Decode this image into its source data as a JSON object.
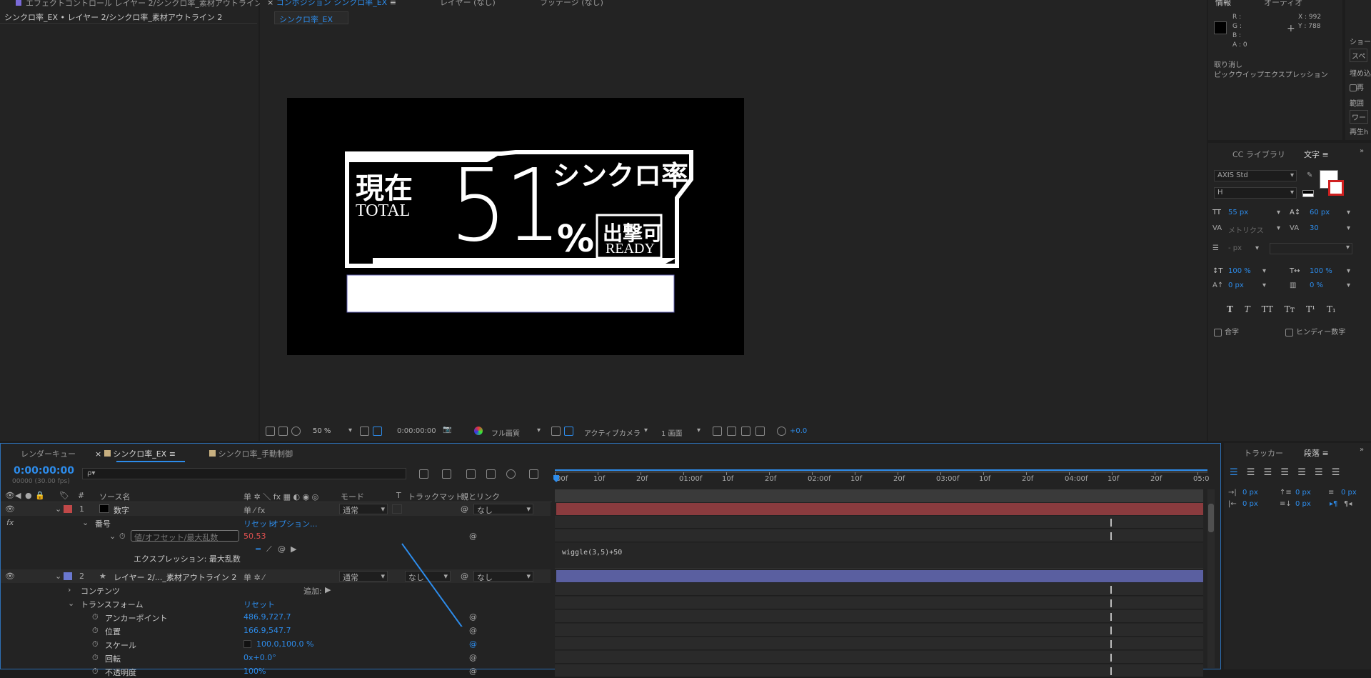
{
  "effects_panel": {
    "tab": "エフェクトコントロール レイヤー 2/シンクロ率_素材アウトライン 2",
    "breadcrumb": "シンクロ率_EX • レイヤー 2/シンクロ率_素材アウトライン 2"
  },
  "comp_panel": {
    "tab": "コンポジション シンクロ率_EX",
    "layer_tab": "レイヤー (なし)",
    "footage_tab": "フッテージ (なし)",
    "comp_chip": "シンクロ率_EX"
  },
  "preview": {
    "genzai": "現在",
    "total": "TOTAL",
    "number": "51",
    "percent": "%",
    "sync_title": "シンクロ率",
    "ready_top": "出撃可",
    "ready_bottom": "READY"
  },
  "viewer_toolbar": {
    "zoom": "50 %",
    "time": "0:00:00:00",
    "quality": "フル画質",
    "camera": "アクティブカメラ",
    "views": "1 画面",
    "exposure": "+0.0"
  },
  "info_panel": {
    "tab_info": "情報",
    "tab_audio": "オーディオ",
    "r": "R :",
    "g": "G :",
    "b": "B :",
    "a": "A : 0",
    "x": "X : 992",
    "y": "Y : 788",
    "undo": "取り消し",
    "pick_expr": "ピックウイップエクスプレッション"
  },
  "right_strip": {
    "t1": "ショー",
    "t2": "スペ",
    "t3": "埋め込",
    "t4": "再",
    "t5": "範囲",
    "t6": "ワー",
    "t7": "再生h"
  },
  "char_panel": {
    "tab_lib": "CC ライブラリ",
    "tab_char": "文字",
    "font": "AXIS Std",
    "style": "H",
    "size": "55 px",
    "leading": "60 px",
    "kerning": "メトリクス",
    "tracking": "30",
    "stroke": "- px",
    "vscale": "100 %",
    "hscale": "100 %",
    "baseline": "0 px",
    "tsume": "0 %",
    "ligature": "合字",
    "hindi": "ヒンディー数字"
  },
  "timeline": {
    "tab_render": "レンダーキュー",
    "tab_comp": "シンクロ率_EX",
    "tab_comp2": "シンクロ率_手動制御",
    "timecode": "0:00:00:00",
    "frames": "00000 (30.00 fps)",
    "search_placeholder": "ρ▾",
    "col_source": "ソース名",
    "col_mode": "モード",
    "col_t": "T",
    "col_track": "トラックマット",
    "col_parent": "親とリンク",
    "ruler": [
      "00f",
      "10f",
      "20f",
      "01:00f",
      "10f",
      "20f",
      "02:00f",
      "10f",
      "20f",
      "03:00f",
      "10f",
      "20f",
      "04:00f",
      "10f",
      "20f",
      "05:0"
    ],
    "layer1": {
      "num": "1",
      "name": "数字",
      "mode": "通常",
      "parent": "なし"
    },
    "prop_number": "番号",
    "reset": "リセット",
    "options": "オプション...",
    "field_placeholder": "値/オフセット/最大乱数",
    "value": "50.53",
    "expr_label": "エクスプレッション: 最大乱数",
    "expression": "wiggle(3,5)+50",
    "layer2": {
      "num": "2",
      "name": "レイヤー 2/..._素材アウトライン 2",
      "mode": "通常",
      "track": "なし",
      "parent": "なし"
    },
    "contents": "コンテンツ",
    "add": "追加:",
    "transform": "トランスフォーム",
    "t_reset": "リセット",
    "anchor": "アンカーポイント",
    "anchor_val": "486.9,727.7",
    "position": "位置",
    "position_val": "166.9,547.7",
    "scale": "スケール",
    "scale_val": "100.0,100.0 %",
    "rotation": "回転",
    "rotation_val": "0x+0.0°",
    "opacity": "不透明度",
    "opacity_val": "100%"
  },
  "tracker_panel": {
    "tab_tracker": "トラッカー",
    "tab_para": "段落",
    "v1": "0 px",
    "v2": "0 px",
    "v3": "0 px",
    "v4": "0 px",
    "v5": "0 px"
  },
  "colors": {
    "accent": "#2d8ceb",
    "layer1": "#c04848",
    "layer2": "#6a78d0",
    "bar1": "#8a3b3e",
    "bar2": "#5a5fa0"
  }
}
